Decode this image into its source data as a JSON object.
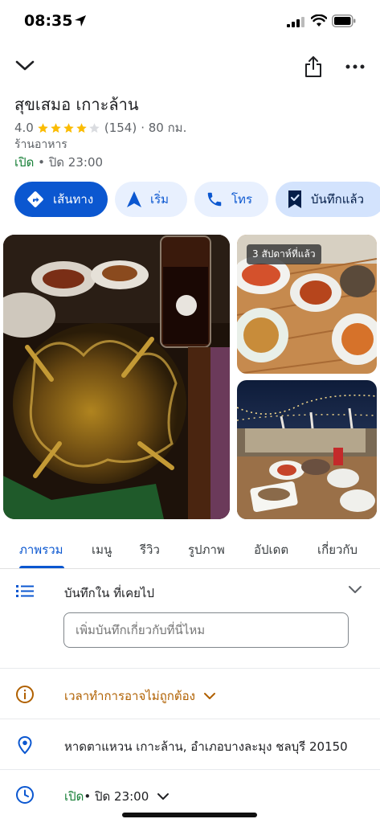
{
  "status_bar": {
    "time": "08:35"
  },
  "place": {
    "title": "สุขเสมอ เกาะล้าน",
    "rating": "4.0",
    "rating_stars": 4,
    "review_count": "(154)",
    "distance": "· 80 กม.",
    "category": "ร้านอาหาร",
    "open_status": "เปิด",
    "close_time": " • ปิด 23:00"
  },
  "actions": [
    {
      "label": "เส้นทาง",
      "icon": "directions-icon"
    },
    {
      "label": "เริ่ม",
      "icon": "navigation-arrow-icon"
    },
    {
      "label": "โทร",
      "icon": "phone-icon"
    },
    {
      "label": "บันทึกแล้ว",
      "icon": "bookmark-icon"
    }
  ],
  "photos": {
    "badge": "3 สัปดาห์ที่แล้ว"
  },
  "tabs": [
    "ภาพรวม",
    "เมนู",
    "รีวิว",
    "รูปภาพ",
    "อัปเดต",
    "เกี่ยวกับ"
  ],
  "lists": {
    "label": "บันทึกใน ที่เคยไป",
    "note_placeholder": "เพิ่มบันทึกเกี่ยวกับที่นี่ไหม"
  },
  "info": {
    "hours_warning": "เวลาทำการอาจไม่ถูกต้อง",
    "address": "หาดตาแหวน เกาะล้าน, อำเภอบางละมุง ชลบุรี 20150",
    "open_status": "เปิด",
    "close_time": " • ปิด 23:00"
  },
  "colors": {
    "accent": "#0b57d0",
    "open": "#188038",
    "warning": "#b06000",
    "star": "#fbbc04"
  }
}
